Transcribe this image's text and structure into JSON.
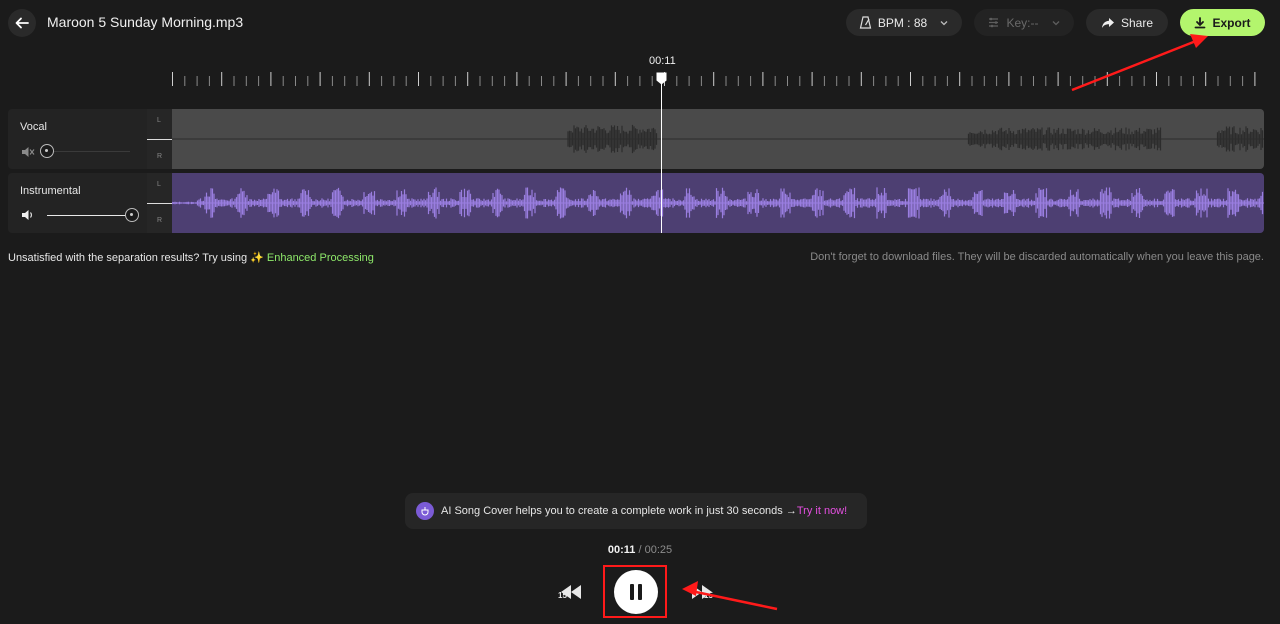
{
  "header": {
    "file_name": "Maroon 5 Sunday Morning.mp3",
    "bpm_label": "BPM : 88",
    "key_label": "Key:--",
    "share_label": "Share",
    "export_label": "Export"
  },
  "timeline": {
    "playhead_time": "00:11"
  },
  "tracks": [
    {
      "name": "Vocal",
      "left_label": "L",
      "right_label": "R",
      "volume": 0,
      "muted": true
    },
    {
      "name": "Instrumental",
      "left_label": "L",
      "right_label": "R",
      "volume": 1,
      "muted": false
    }
  ],
  "info": {
    "prompt_text": "Unsatisfied with the separation results? Try using ",
    "enhanced_label": "✨ Enhanced Processing",
    "download_notice": "Don't forget to download files. They will be discarded automatically when you leave this page."
  },
  "promo": {
    "text": "AI Song Cover helps you to create a complete work in just 30 seconds → ",
    "cta": "Try it now!"
  },
  "player": {
    "current_time": "00:11",
    "separator": " / ",
    "total_time": "00:25",
    "rewind_label": "15",
    "forward_label": "15",
    "progress": 0.44
  },
  "colors": {
    "accent_green": "#b3f56d",
    "instrumental_wave": "#9a7ee0",
    "vocal_wave": "#2c2c2c",
    "promo_cta": "#e44fe0",
    "annotation_red": "#ff1a1a"
  }
}
